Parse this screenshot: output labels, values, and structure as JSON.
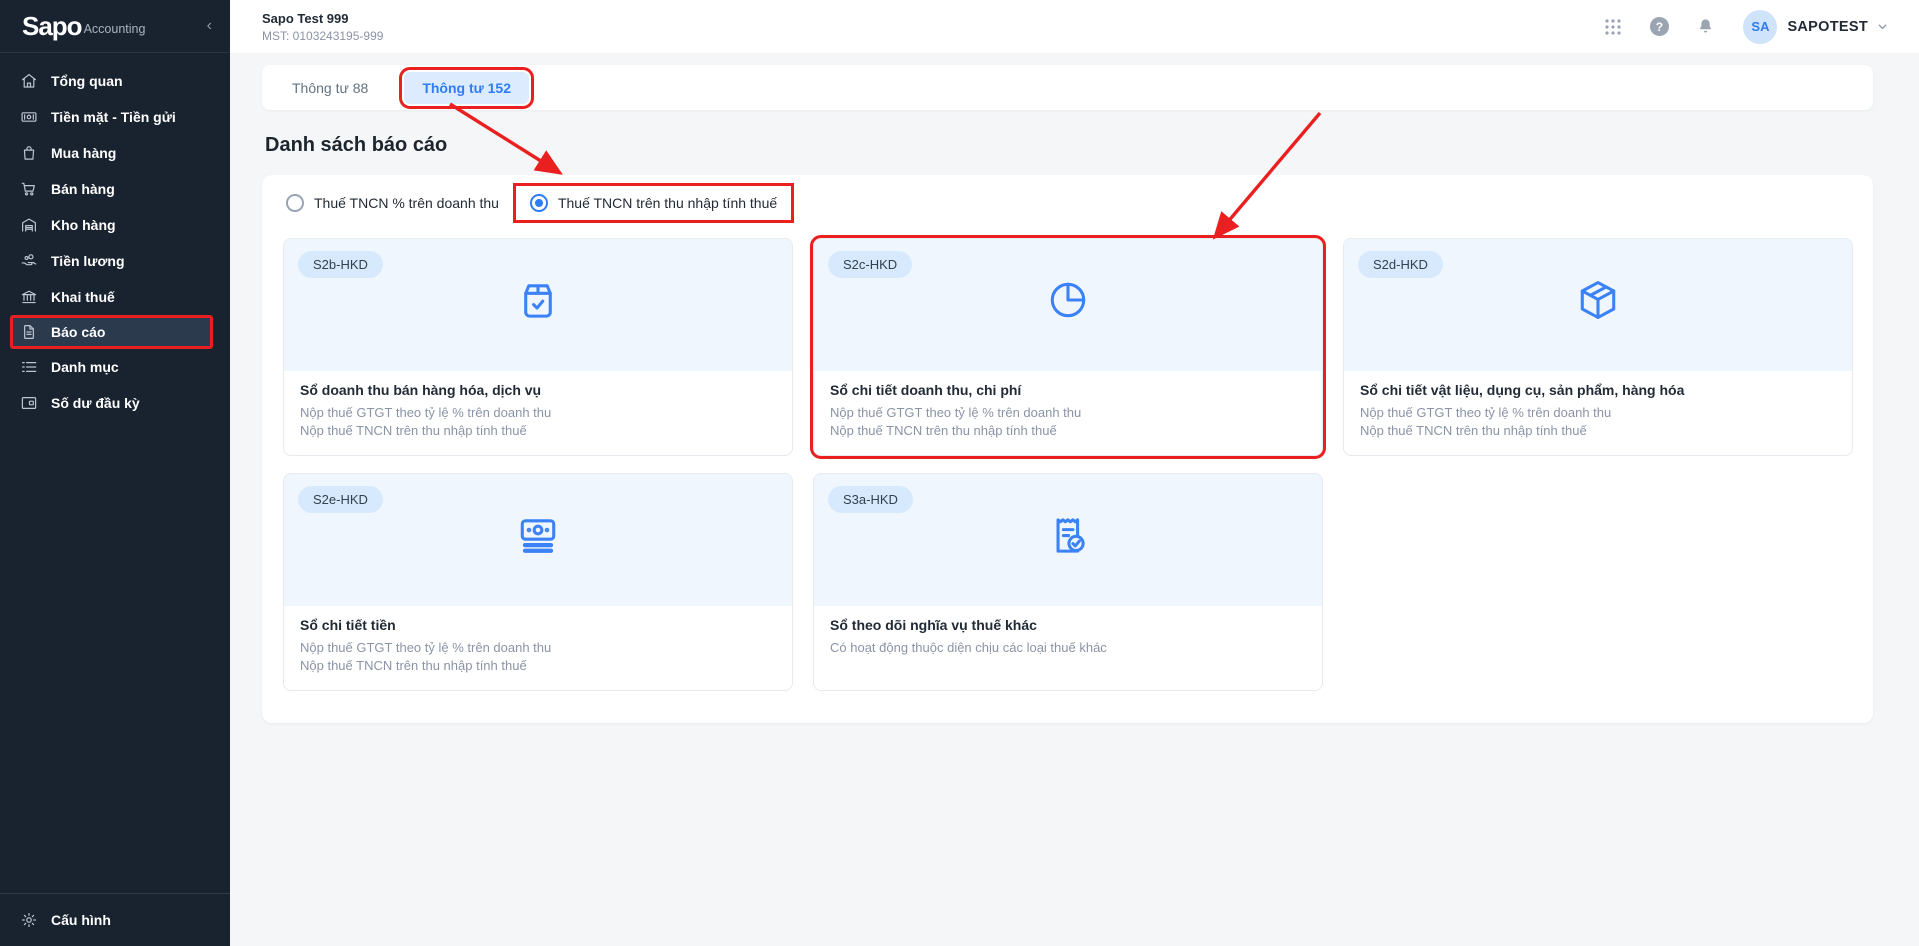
{
  "colors": {
    "accent_blue": "#2e7cf6",
    "icon_blue": "#3b82f6",
    "annotation_red": "#e9201f",
    "sidebar_bg": "#19222f",
    "sidebar_active_bg": "#2c3a4e",
    "content_bg": "#f4f6f8",
    "card_top_bg": "#f0f6fe",
    "badge_bg": "#d7e9fd",
    "tab_pill_bg": "#dcebfe"
  },
  "brand": {
    "name": "Sapo",
    "suffix": "Accounting",
    "collapse_glyph": "‹"
  },
  "header": {
    "company_name": "Sapo Test 999",
    "tax_code": "MST: 0103243195-999",
    "help_glyph": "?",
    "user": {
      "initials": "SA",
      "name": "SAPOTEST"
    }
  },
  "sidebar": {
    "items": [
      {
        "label": "Tổng quan",
        "icon": "home-icon"
      },
      {
        "label": "Tiền mặt - Tiền gửi",
        "icon": "banknote-icon"
      },
      {
        "label": "Mua hàng",
        "icon": "shopping-bag-icon"
      },
      {
        "label": "Bán hàng",
        "icon": "shopping-cart-icon"
      },
      {
        "label": "Kho hàng",
        "icon": "warehouse-icon"
      },
      {
        "label": "Tiền lương",
        "icon": "hand-coins-icon"
      },
      {
        "label": "Khai thuế",
        "icon": "bank-building-icon"
      },
      {
        "label": "Báo cáo",
        "icon": "report-document-icon",
        "active": true,
        "annotated": true
      },
      {
        "label": "Danh mục",
        "icon": "list-icon"
      },
      {
        "label": "Số dư đầu kỳ",
        "icon": "wallet-icon"
      }
    ],
    "footer": {
      "label": "Cấu hình",
      "icon": "gear-icon"
    }
  },
  "tabs": [
    {
      "label": "Thông tư 88",
      "active": false
    },
    {
      "label": "Thông tư 152",
      "active": true,
      "annotated": true
    }
  ],
  "page": {
    "title": "Danh sách báo cáo"
  },
  "tax_method_options": [
    {
      "label": "Thuế TNCN % trên doanh thu",
      "selected": false
    },
    {
      "label": "Thuế TNCN trên thu nhập tính thuế",
      "selected": true,
      "annotated": true
    }
  ],
  "report_cards": [
    {
      "badge": "S2b-HKD",
      "icon": "package-check-icon",
      "title": "Sổ doanh thu bán hàng hóa, dịch vụ",
      "desc": [
        "Nộp thuế GTGT theo tỷ lệ % trên doanh thu",
        "Nộp thuế TNCN trên thu nhập tính thuế"
      ]
    },
    {
      "badge": "S2c-HKD",
      "icon": "pie-chart-icon",
      "title": "Sổ chi tiết doanh thu, chi phí",
      "desc": [
        "Nộp thuế GTGT theo tỷ lệ % trên doanh thu",
        "Nộp thuế TNCN trên thu nhập tính thuế"
      ],
      "annotated": true
    },
    {
      "badge": "S2d-HKD",
      "icon": "package-3d-icon",
      "title": "Sổ chi tiết vật liệu, dụng cụ, sản phẩm, hàng hóa",
      "desc": [
        "Nộp thuế GTGT theo tỷ lệ % trên doanh thu",
        "Nộp thuế TNCN trên thu nhập tính thuế"
      ]
    },
    {
      "badge": "S2e-HKD",
      "icon": "cash-stack-icon",
      "title": "Sổ chi tiết tiền",
      "desc": [
        "Nộp thuế GTGT theo tỷ lệ % trên doanh thu",
        "Nộp thuế TNCN trên thu nhập tính thuế"
      ]
    },
    {
      "badge": "S3a-HKD",
      "icon": "receipt-check-icon",
      "title": "Sổ theo dõi nghĩa vụ thuế khác",
      "desc": [
        "Có hoạt động thuộc diện chịu các loại thuế khác"
      ]
    }
  ]
}
